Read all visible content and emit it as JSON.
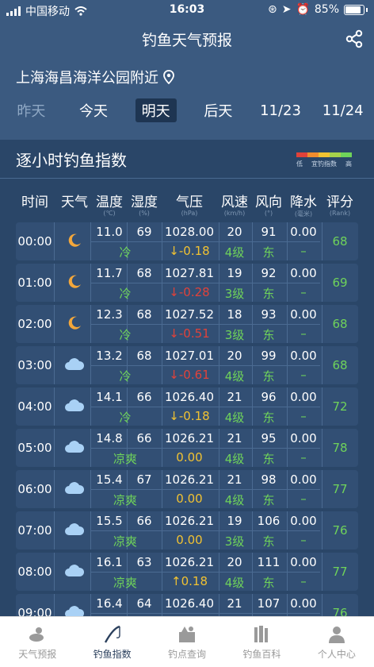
{
  "status_bar": {
    "carrier": "中国移动",
    "time": "16:03",
    "battery": "85%"
  },
  "nav": {
    "title": "钓鱼天气预报"
  },
  "location": "上海海昌海洋公园附近",
  "day_tabs": [
    "昨天",
    "今天",
    "明天",
    "后天",
    "11/23",
    "11/24"
  ],
  "active_tab": "明天",
  "panel": {
    "title": "逐小时钓鱼指数",
    "legend": {
      "low": "低",
      "mid": "宜钓指数",
      "high": "高",
      "colors": [
        "#e0423a",
        "#f08c2e",
        "#f1c232",
        "#a6d14b",
        "#6fd35a"
      ]
    }
  },
  "columns": [
    {
      "label": "时间",
      "unit": ""
    },
    {
      "label": "天气",
      "unit": ""
    },
    {
      "label": "温度",
      "unit": "(℃)"
    },
    {
      "label": "湿度",
      "unit": "(%)"
    },
    {
      "label": "气压",
      "unit": "(hPa)"
    },
    {
      "label": "风速",
      "unit": "(km/h)"
    },
    {
      "label": "风向",
      "unit": "(°)"
    },
    {
      "label": "降水",
      "unit": "(毫米)"
    },
    {
      "label": "评分",
      "unit": "(Rank)"
    }
  ],
  "rows": [
    {
      "time": "00:00",
      "weather": "moon",
      "temp": "11.0",
      "feel": "冷",
      "humidity": "69",
      "pressure": "1028.00",
      "pchange": "↓-0.18",
      "pcolor": "yellow",
      "wind": "20",
      "level": "4级",
      "dir": "91",
      "dirname": "东",
      "rain": "0.00",
      "rain2": "–",
      "score": "68"
    },
    {
      "time": "01:00",
      "weather": "moon",
      "temp": "11.7",
      "feel": "冷",
      "humidity": "68",
      "pressure": "1027.81",
      "pchange": "↓-0.28",
      "pcolor": "red",
      "wind": "19",
      "level": "3级",
      "dir": "92",
      "dirname": "东",
      "rain": "0.00",
      "rain2": "–",
      "score": "69"
    },
    {
      "time": "02:00",
      "weather": "moon",
      "temp": "12.3",
      "feel": "冷",
      "humidity": "68",
      "pressure": "1027.52",
      "pchange": "↓-0.51",
      "pcolor": "red",
      "wind": "18",
      "level": "3级",
      "dir": "93",
      "dirname": "东",
      "rain": "0.00",
      "rain2": "–",
      "score": "68"
    },
    {
      "time": "03:00",
      "weather": "cloud",
      "temp": "13.2",
      "feel": "冷",
      "humidity": "68",
      "pressure": "1027.01",
      "pchange": "↓-0.61",
      "pcolor": "red",
      "wind": "20",
      "level": "4级",
      "dir": "99",
      "dirname": "东",
      "rain": "0.00",
      "rain2": "–",
      "score": "68"
    },
    {
      "time": "04:00",
      "weather": "cloud",
      "temp": "14.1",
      "feel": "冷",
      "humidity": "66",
      "pressure": "1026.40",
      "pchange": "↓-0.18",
      "pcolor": "yellow",
      "wind": "21",
      "level": "4级",
      "dir": "96",
      "dirname": "东",
      "rain": "0.00",
      "rain2": "–",
      "score": "72"
    },
    {
      "time": "05:00",
      "weather": "cloud",
      "temp": "14.8",
      "feel": "凉爽",
      "humidity": "66",
      "pressure": "1026.21",
      "pchange": "0.00",
      "pcolor": "yellow",
      "wind": "21",
      "level": "4级",
      "dir": "95",
      "dirname": "东",
      "rain": "0.00",
      "rain2": "–",
      "score": "78"
    },
    {
      "time": "06:00",
      "weather": "cloud",
      "temp": "15.4",
      "feel": "凉爽",
      "humidity": "67",
      "pressure": "1026.21",
      "pchange": "0.00",
      "pcolor": "yellow",
      "wind": "21",
      "level": "4级",
      "dir": "98",
      "dirname": "东",
      "rain": "0.00",
      "rain2": "–",
      "score": "77"
    },
    {
      "time": "07:00",
      "weather": "cloud",
      "temp": "15.5",
      "feel": "凉爽",
      "humidity": "66",
      "pressure": "1026.21",
      "pchange": "0.00",
      "pcolor": "yellow",
      "wind": "19",
      "level": "3级",
      "dir": "106",
      "dirname": "东",
      "rain": "0.00",
      "rain2": "–",
      "score": "76"
    },
    {
      "time": "08:00",
      "weather": "cloud",
      "temp": "16.1",
      "feel": "凉爽",
      "humidity": "63",
      "pressure": "1026.21",
      "pchange": "↑0.18",
      "pcolor": "yellow",
      "wind": "20",
      "level": "4级",
      "dir": "111",
      "dirname": "东",
      "rain": "0.00",
      "rain2": "–",
      "score": "77"
    },
    {
      "time": "09:00",
      "weather": "cloud",
      "temp": "16.4",
      "feel": "",
      "humidity": "64",
      "pressure": "1026.40",
      "pchange": "",
      "pcolor": "yellow",
      "wind": "21",
      "level": "",
      "dir": "107",
      "dirname": "",
      "rain": "0.00",
      "rain2": "",
      "score": "76"
    }
  ],
  "bottom_tabs": [
    {
      "label": "天气预报",
      "icon": "weather-icon"
    },
    {
      "label": "钓鱼指数",
      "icon": "fishing-rod-icon"
    },
    {
      "label": "钓点查询",
      "icon": "map-spot-icon"
    },
    {
      "label": "钓鱼百科",
      "icon": "books-icon"
    },
    {
      "label": "个人中心",
      "icon": "user-icon"
    }
  ],
  "active_bottom": "钓鱼指数"
}
